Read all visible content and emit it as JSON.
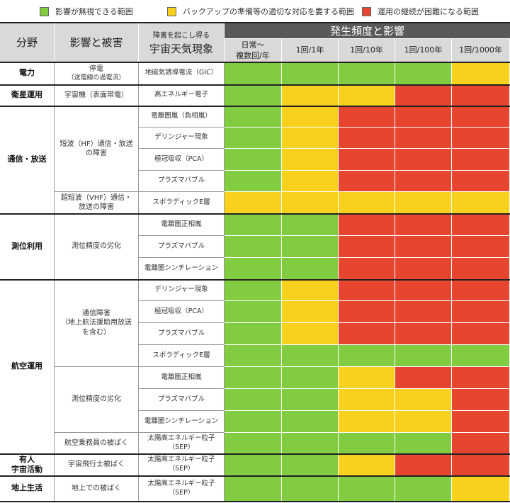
{
  "legend": {
    "items": [
      {
        "label": "影響が無視できる範囲",
        "color": "#81cc40"
      },
      {
        "label": "バックアップの準備等の適切な対応を要する範囲",
        "color": "#f7d11e"
      },
      {
        "label": "運用の継続が困難になる範囲",
        "color": "#e64530"
      }
    ]
  },
  "header": {
    "field": "分野",
    "impact": "影響と被害",
    "phenomenon_small": "障害を起こし得る",
    "phenomenon_large": "宇宙天気現象",
    "frequency_title": "発生頻度と影響",
    "frequencies": [
      "日常～\n複数回/年",
      "1回/1年",
      "1回/10年",
      "1回/100年",
      "1回/1000年"
    ]
  },
  "colors": {
    "G": "#81cc40",
    "Y": "#f7d11e",
    "R": "#e64530"
  },
  "fields": [
    {
      "label": "電力"
    },
    {
      "label": "衛星運用"
    },
    {
      "label": "通信・放送"
    },
    {
      "label": "測位利用"
    },
    {
      "label": "航空運用"
    },
    {
      "label": "有人\n宇宙活動"
    },
    {
      "label": "地上生活"
    }
  ],
  "impacts": [
    {
      "label": "停電"
    },
    {
      "label": "（送電線の過電流）"
    },
    {
      "label": "宇宙機（表面帯電）"
    },
    {
      "label": "短波（HF）通信・放送\nの障害"
    },
    {
      "label": "超短波（VHF）通信・\n放送の障害"
    },
    {
      "label": "測位精度の劣化"
    },
    {
      "label": "通信障害\n（地上航法援助用放送\nを含む）"
    },
    {
      "label": "測位精度の劣化"
    },
    {
      "label": "航空乗務員の被ばく"
    },
    {
      "label": "宇宙飛行士被ばく"
    },
    {
      "label": "地上での被ばく"
    }
  ],
  "rows": [
    {
      "phenomenon": "地磁気誘導電流（GIC）",
      "levels": [
        "G",
        "G",
        "G",
        "G",
        "Y"
      ]
    },
    {
      "phenomenon": "高エネルギー電子",
      "levels": [
        "G",
        "Y",
        "Y",
        "R",
        "R"
      ]
    },
    {
      "phenomenon": "電離圏嵐（負相嵐）",
      "levels": [
        "G",
        "Y",
        "R",
        "R",
        "R"
      ]
    },
    {
      "phenomenon": "デリンジャー現象",
      "levels": [
        "G",
        "Y",
        "R",
        "R",
        "R"
      ]
    },
    {
      "phenomenon": "極冠吸収（PCA）",
      "levels": [
        "G",
        "Y",
        "R",
        "R",
        "R"
      ]
    },
    {
      "phenomenon": "プラズマバブル",
      "levels": [
        "G",
        "Y",
        "R",
        "R",
        "R"
      ]
    },
    {
      "phenomenon": "スポラディックE層",
      "levels": [
        "Y",
        "Y",
        "Y",
        "Y",
        "Y"
      ]
    },
    {
      "phenomenon": "電離圏正相嵐",
      "levels": [
        "G",
        "G",
        "R",
        "R",
        "R"
      ]
    },
    {
      "phenomenon": "プラズマバブル",
      "levels": [
        "G",
        "G",
        "R",
        "R",
        "R"
      ]
    },
    {
      "phenomenon": "電離圏シンチレーション",
      "levels": [
        "G",
        "G",
        "R",
        "R",
        "R"
      ]
    },
    {
      "phenomenon": "デリンジャー現象",
      "levels": [
        "G",
        "Y",
        "R",
        "R",
        "R"
      ]
    },
    {
      "phenomenon": "極冠吸収（PCA）",
      "levels": [
        "G",
        "Y",
        "R",
        "R",
        "R"
      ]
    },
    {
      "phenomenon": "プラズマバブル",
      "levels": [
        "G",
        "Y",
        "R",
        "R",
        "R"
      ]
    },
    {
      "phenomenon": "スポラディックE層",
      "levels": [
        "G",
        "G",
        "G",
        "G",
        "G"
      ]
    },
    {
      "phenomenon": "電離圏正相嵐",
      "levels": [
        "G",
        "G",
        "Y",
        "R",
        "R"
      ]
    },
    {
      "phenomenon": "プラズマバブル",
      "levels": [
        "G",
        "G",
        "Y",
        "Y",
        "R"
      ]
    },
    {
      "phenomenon": "電離圏シンチレーション",
      "levels": [
        "G",
        "G",
        "Y",
        "Y",
        "R"
      ]
    },
    {
      "phenomenon": "太陽高エネルギー粒子\n（SEP）",
      "levels": [
        "G",
        "G",
        "G",
        "G",
        "R"
      ]
    },
    {
      "phenomenon": "太陽高エネルギー粒子\n（SEP）",
      "levels": [
        "G",
        "G",
        "Y",
        "R",
        "R"
      ]
    },
    {
      "phenomenon": "太陽高エネルギー粒子\n（SEP）",
      "levels": [
        "G",
        "G",
        "G",
        "G",
        "Y"
      ]
    }
  ]
}
